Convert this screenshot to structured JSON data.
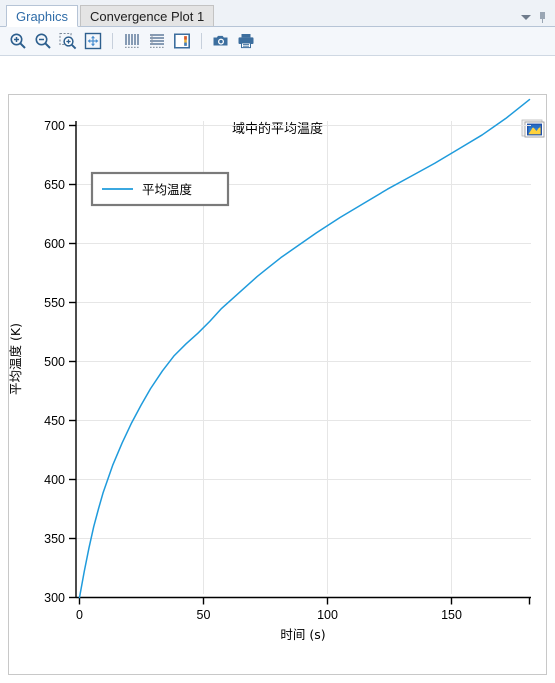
{
  "window": {
    "tabs": [
      {
        "label": "Graphics",
        "active": true
      },
      {
        "label": "Convergence Plot 1",
        "active": false
      }
    ],
    "tabbar_controls": [
      "chevron-down-icon",
      "pin-icon"
    ]
  },
  "toolbar": {
    "buttons": [
      {
        "name": "zoom-in-button",
        "icon": "zoom-in-icon"
      },
      {
        "name": "zoom-out-button",
        "icon": "zoom-out-icon"
      },
      {
        "name": "zoom-box-button",
        "icon": "zoom-box-icon"
      },
      {
        "name": "zoom-extents-button",
        "icon": "zoom-extents-icon"
      },
      {
        "name": "grid-lines-button",
        "icon": "grid-vertical-icon"
      },
      {
        "name": "grid-table-button",
        "icon": "grid-horizontal-icon"
      },
      {
        "name": "plot-colors-button",
        "icon": "color-plot-icon"
      },
      {
        "name": "snapshot-button",
        "icon": "camera-icon"
      },
      {
        "name": "print-button",
        "icon": "printer-icon"
      }
    ]
  },
  "plot": {
    "thumbnail_icon": "image-thumbnail-icon",
    "accent_color": "#1f9bdc",
    "grid_color": "#e6e6e6",
    "axis_color": "#000000"
  },
  "chart_data": {
    "type": "line",
    "title": "域中的平均温度",
    "xlabel": "时间 (s)",
    "ylabel": "平均温度 (K)",
    "xlim": [
      0,
      190
    ],
    "ylim": [
      300,
      725
    ],
    "xticks": [
      0,
      50,
      100,
      150
    ],
    "yticks": [
      300,
      350,
      400,
      450,
      500,
      550,
      600,
      650,
      700
    ],
    "grid": true,
    "legend_position": "top-left",
    "series": [
      {
        "name": "平均温度",
        "color": "#1f9bdc",
        "x": [
          0,
          2,
          4,
          6,
          8,
          10,
          14,
          18,
          22,
          26,
          30,
          35,
          40,
          45,
          50,
          55,
          60,
          65,
          70,
          75,
          80,
          85,
          90,
          95,
          100,
          110,
          120,
          130,
          140,
          150,
          160,
          170,
          180,
          190
        ],
        "y": [
          300,
          322,
          342,
          360,
          375,
          389,
          412,
          431,
          448,
          463,
          477,
          492,
          505,
          515,
          524,
          534,
          545,
          554,
          563,
          572,
          580,
          588,
          595,
          602,
          609,
          622,
          634,
          646,
          657,
          668,
          680,
          692,
          706,
          722
        ]
      }
    ]
  }
}
